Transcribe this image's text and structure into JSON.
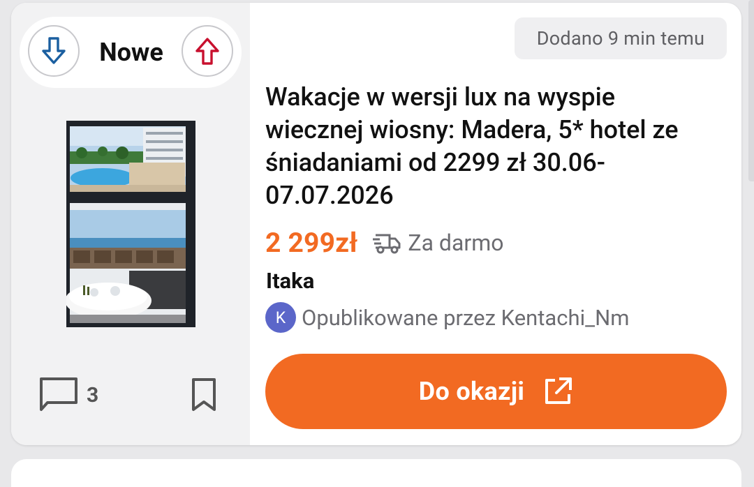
{
  "deal": {
    "posted_time": "Dodano 9 min temu",
    "vote_label": "Nowe",
    "title": "Wakacje w wersji lux na wyspie wiecznej wiosny: Madera, 5* hotel ze śniadaniami od 2299 zł 30.06-07.07.2026",
    "price": "2 299zł",
    "shipping": "Za darmo",
    "merchant": "Itaka",
    "poster_initial": "K",
    "poster_text": "Opublikowane przez Kentachi_Nm",
    "comments_count": "3",
    "cta_label": "Do okazji"
  },
  "colors": {
    "accent": "#f26a22",
    "vote_down": "#1b5fa0",
    "vote_up": "#c8102e",
    "avatar": "#5b66c9"
  },
  "icons": {
    "vote_down": "arrow-down-icon",
    "vote_up": "arrow-up-icon",
    "shipping": "delivery-truck-icon",
    "comments": "comment-icon",
    "bookmark": "bookmark-icon",
    "cta": "external-link-icon"
  }
}
